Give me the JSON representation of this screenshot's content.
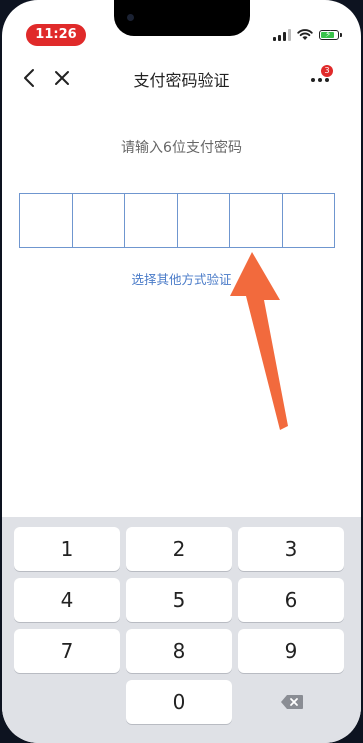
{
  "status_bar": {
    "time": "11:26"
  },
  "nav": {
    "title": "支付密码验证",
    "badge_count": "3"
  },
  "main": {
    "prompt": "请输入6位支付密码",
    "pin_cells": [
      "",
      "",
      "",
      "",
      "",
      ""
    ],
    "alt_link": "选择其他方式验证"
  },
  "keyboard": {
    "keys": [
      "1",
      "2",
      "3",
      "4",
      "5",
      "6",
      "7",
      "8",
      "9",
      "0"
    ]
  },
  "colors": {
    "accent": "#4a7bc8",
    "badge": "#e02a2a",
    "arrow": "#f26a3d",
    "battery": "#39c24a"
  }
}
